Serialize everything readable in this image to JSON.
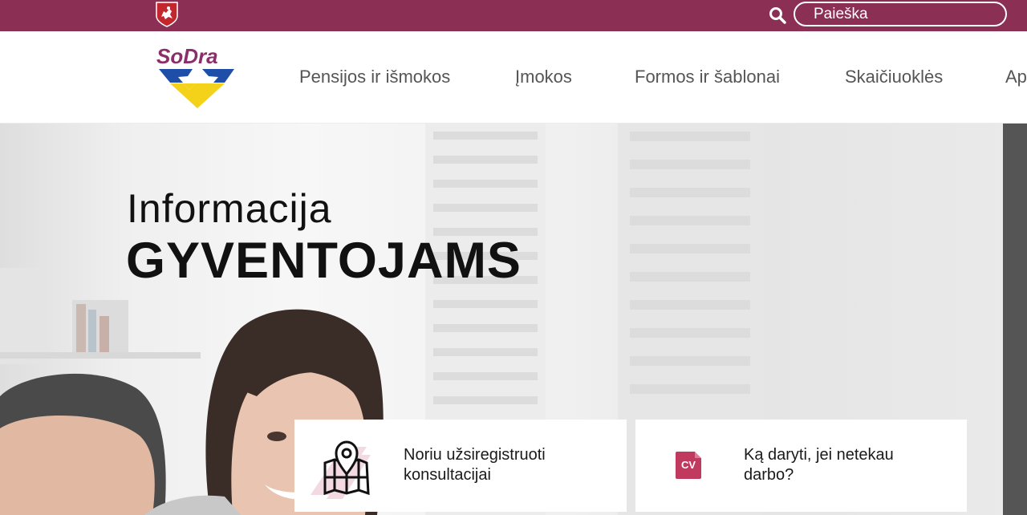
{
  "topbar": {
    "coat_of_arms_icon": "vytis-coat-of-arms-icon",
    "search_icon": "search-icon",
    "search_placeholder": "Paieška",
    "background_color": "#8b2f55"
  },
  "header": {
    "logo_text": "SoDra",
    "nav": [
      {
        "label": "Pensijos ir išmokos"
      },
      {
        "label": "Įmokos"
      },
      {
        "label": "Formos ir šablonai"
      },
      {
        "label": "Skaičiuoklės"
      },
      {
        "label": "Ap"
      }
    ]
  },
  "hero": {
    "title_light": "Informacija",
    "title_bold": "GYVENTOJAMS"
  },
  "cards": [
    {
      "text": "Noriu užsiregistruoti konsultacijai",
      "icon": "map-pin-icon"
    },
    {
      "text": "Ką daryti, jei netekau darbo?",
      "icon": "cv-icon",
      "badge": "CV"
    }
  ],
  "colors": {
    "brand": "#8b2f55",
    "logo_purple": "#8b2f6b",
    "logo_blue": "#1f4ea8",
    "logo_yellow": "#f5d21a",
    "cv_badge": "#c0395f"
  }
}
